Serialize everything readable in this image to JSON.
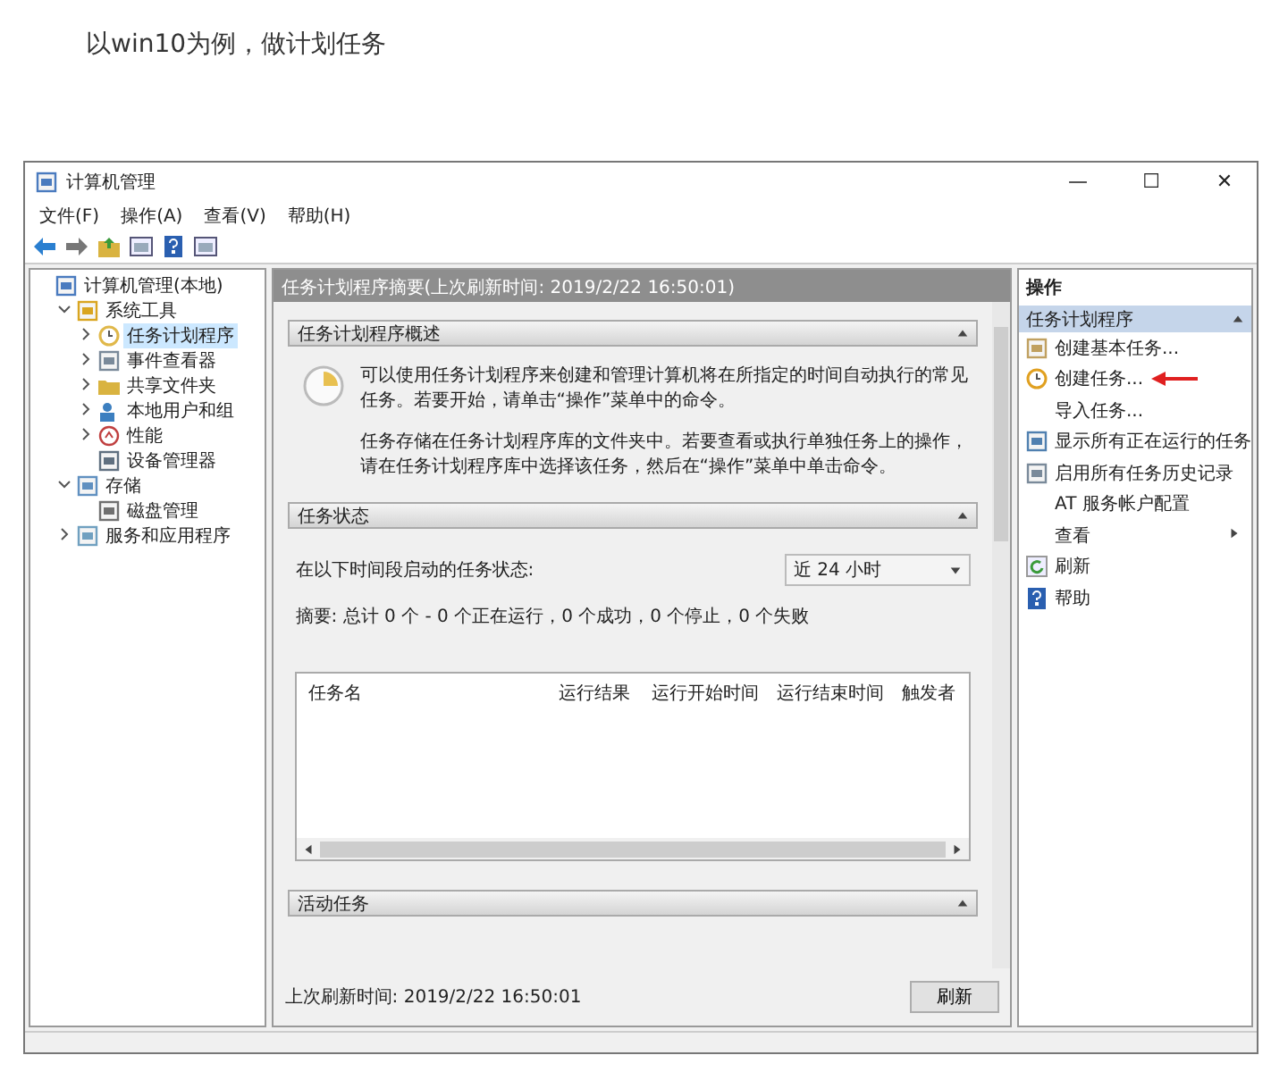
{
  "caption": "以win10为例，做计划任务",
  "window": {
    "title": "计算机管理",
    "controls": [
      "—",
      "☐",
      "✕"
    ]
  },
  "menu": [
    "文件(F)",
    "操作(A)",
    "查看(V)",
    "帮助(H)"
  ],
  "tree": [
    {
      "label": "计算机管理(本地)",
      "children": [
        {
          "label": "系统工具",
          "expanded": true,
          "children": [
            {
              "label": "任务计划程序",
              "expanded": false,
              "selected": true
            },
            {
              "label": "事件查看器",
              "expanded": false,
              "selected": false
            },
            {
              "label": "共享文件夹",
              "expanded": false,
              "selected": false
            },
            {
              "label": "本地用户和组",
              "expanded": false,
              "selected": false
            },
            {
              "label": "性能",
              "expanded": false,
              "selected": false
            },
            {
              "label": "设备管理器",
              "selected": false
            }
          ]
        },
        {
          "label": "存储",
          "expanded": true,
          "children": [
            {
              "label": "磁盘管理",
              "selected": false
            }
          ]
        },
        {
          "label": "服务和应用程序",
          "expanded": false
        }
      ]
    }
  ],
  "center": {
    "header": "任务计划程序摘要(上次刷新时间: 2019/2/22 16:50:01)",
    "overview": {
      "title": "任务计划程序概述",
      "paragraphs": [
        "可以使用任务计划程序来创建和管理计算机将在所指定的时间自动执行的常见任务。若要开始，请单击“操作”菜单中的命令。",
        "任务存储在任务计划程序库的文件夹中。若要查看或执行单独任务上的操作，请在任务计划程序库中选择该任务，然后在“操作”菜单中单击命令。"
      ]
    },
    "status": {
      "title": "任务状态",
      "label": "在以下时间段启动的任务状态:",
      "period": "近 24 小时",
      "summary": "摘要: 总计 0 个 - 0 个正在运行，0 个成功，0 个停止，0 个失败",
      "columns": [
        "任务名",
        "运行结果",
        "运行开始时间",
        "运行结束时间",
        "触发者"
      ]
    },
    "active": {
      "title": "活动任务"
    },
    "footer": "上次刷新时间: 2019/2/22 16:50:01",
    "refresh": "刷新"
  },
  "actions": {
    "title": "操作",
    "group": "任务计划程序",
    "items": [
      {
        "label": "创建基本任务..."
      },
      {
        "label": "创建任务...",
        "annotated": true
      },
      {
        "label": "导入任务..."
      },
      {
        "label": "显示所有正在运行的任务"
      },
      {
        "label": "启用所有任务历史记录"
      },
      {
        "label": "AT 服务帐户配置"
      },
      {
        "label": "查看",
        "submenu": true
      },
      {
        "label": "刷新"
      },
      {
        "label": "帮助"
      }
    ]
  }
}
